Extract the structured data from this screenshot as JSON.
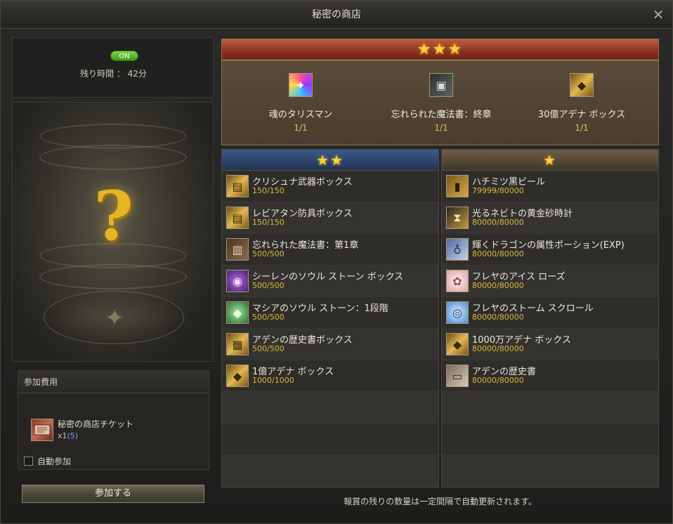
{
  "window": {
    "title": "秘密の商店",
    "close_icon": "×"
  },
  "status": {
    "badge": "ON",
    "remaining": "残り時間 ： 42分"
  },
  "mystery": {
    "symbol": "?"
  },
  "cost": {
    "header": "参加費用",
    "ticket_name": "秘密の商店チケット",
    "ticket_qty_prefix": "x1",
    "ticket_qty_owned": "(5)",
    "auto_join_label": "自動参加",
    "auto_join_checked": false
  },
  "join_button": "参加する",
  "tier3": {
    "stars": "★★★",
    "items": [
      {
        "name": "魂のタリスマン",
        "count": "1/1",
        "icon": "talisman-icon"
      },
      {
        "name": "忘れられた魔法書：終章",
        "count": "1/1",
        "icon": "spellbook-icon"
      },
      {
        "name": "30億アデナ ボックス",
        "count": "1/1",
        "icon": "adena-box-icon"
      }
    ]
  },
  "tier2": {
    "stars": "★★",
    "items": [
      {
        "name": "クリシュナ武器ボックス",
        "count": "150/150",
        "icon": "weapon-box-icon"
      },
      {
        "name": "レビアタン防具ボックス",
        "count": "150/150",
        "icon": "armor-box-icon"
      },
      {
        "name": "忘れられた魔法書：第1章",
        "count": "500/500",
        "icon": "spellbook-icon"
      },
      {
        "name": "シーレンのソウル ストーン ボックス",
        "count": "500/500",
        "icon": "soulstone-box-icon"
      },
      {
        "name": "マシアのソウル ストーン：1段階",
        "count": "500/500",
        "icon": "soulstone-icon"
      },
      {
        "name": "アデンの歴史書ボックス",
        "count": "500/500",
        "icon": "history-box-icon"
      },
      {
        "name": "1億アデナ ボックス",
        "count": "1000/1000",
        "icon": "adena-box-icon"
      }
    ]
  },
  "tier1": {
    "stars": "★",
    "items": [
      {
        "name": "ハチミツ黒ビール",
        "count": "79999/80000",
        "icon": "beer-icon"
      },
      {
        "name": "光るネビトの黄金砂時計",
        "count": "80000/80000",
        "icon": "hourglass-icon"
      },
      {
        "name": "輝くドラゴンの属性ポーション(EXP)",
        "count": "80000/80000",
        "icon": "potion-icon"
      },
      {
        "name": "フレヤのアイス ローズ",
        "count": "80000/80000",
        "icon": "rose-icon"
      },
      {
        "name": "フレヤのストーム スクロール",
        "count": "80000/80000",
        "icon": "scroll-icon"
      },
      {
        "name": "1000万アデナ ボックス",
        "count": "80000/80000",
        "icon": "adena-box-icon"
      },
      {
        "name": "アデンの歴史書",
        "count": "80000/80000",
        "icon": "history-book-icon"
      }
    ]
  },
  "footer_note": "報賞の残りの数量は一定間隔で自動更新されます。"
}
